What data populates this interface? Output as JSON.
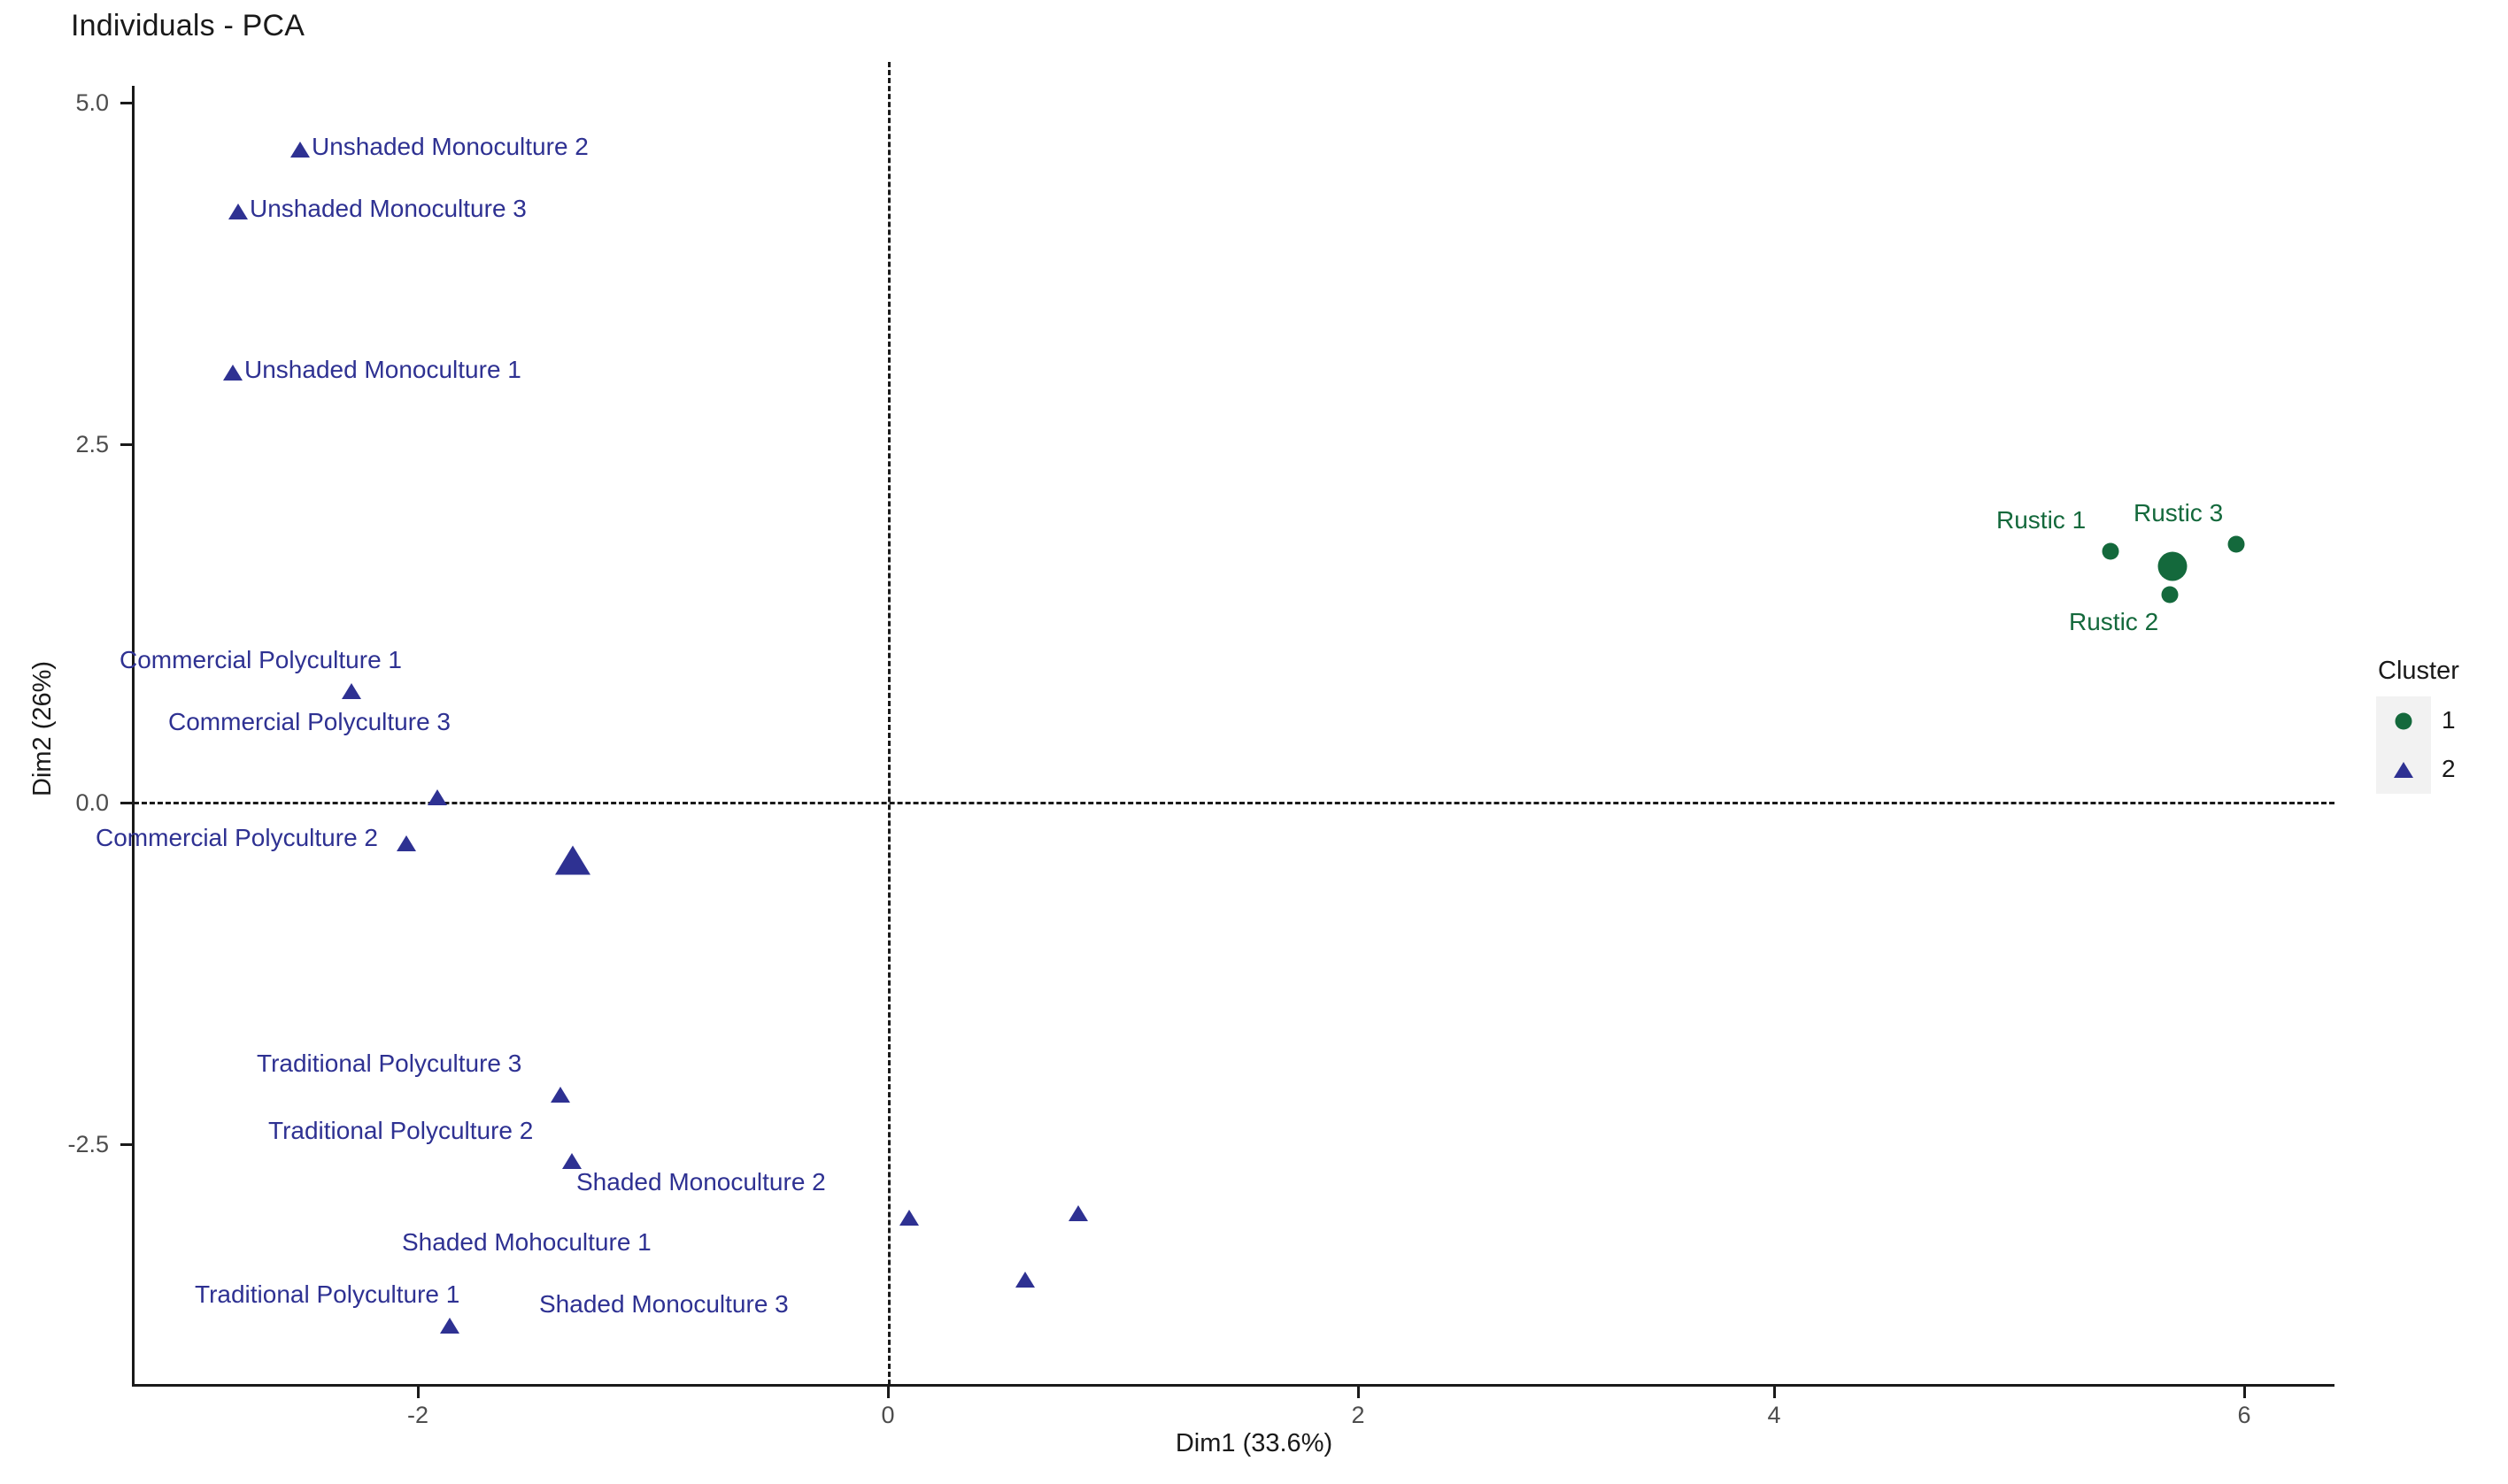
{
  "chart_data": {
    "type": "scatter",
    "title": "Individuals - PCA",
    "xlabel": "Dim1 (33.6%)",
    "ylabel": "Dim2 (26%)",
    "xlim": [
      -3.3,
      6.6
    ],
    "ylim": [
      -4.05,
      5.35
    ],
    "xticks": [
      -2,
      0,
      2,
      4,
      6
    ],
    "xtick_labels": [
      "-2",
      "0",
      "2",
      "4",
      "6"
    ],
    "yticks": [
      -2.5,
      0.0,
      2.5,
      5.0
    ],
    "ytick_labels": [
      "-2.5",
      "0.0",
      "2.5",
      "5.0"
    ],
    "grid": false,
    "reference_lines": {
      "h": 0.0,
      "v": 0.0,
      "style": "dashed"
    },
    "legend": {
      "title": "Cluster",
      "position": "right",
      "entries": [
        {
          "label": "1",
          "color": "#14693c",
          "marker": "circle"
        },
        {
          "label": "2",
          "color": "#2e3192",
          "marker": "triangle"
        }
      ]
    },
    "series": [
      {
        "name": "1",
        "color": "#14693c",
        "marker": "circle",
        "points": [
          {
            "label": "Rustic 1",
            "x": 5.19,
            "y": 1.79,
            "label_pos": "left-above"
          },
          {
            "label": "Rustic 2",
            "x": 5.45,
            "y": 1.47,
            "label_pos": "below"
          },
          {
            "label": "Rustic 3",
            "x": 5.73,
            "y": 1.84,
            "label_pos": "above"
          }
        ],
        "centroid": {
          "x": 5.46,
          "y": 1.69
        }
      },
      {
        "name": "2",
        "color": "#2e3192",
        "marker": "triangle",
        "points": [
          {
            "label": "Unshaded Monoculture 2",
            "x": -2.5,
            "y": 4.78,
            "label_pos": "right"
          },
          {
            "label": "Unshaded Monoculture 3",
            "x": -2.77,
            "y": 4.33,
            "label_pos": "right"
          },
          {
            "label": "Unshaded Monoculture 1",
            "x": -2.79,
            "y": 3.15,
            "label_pos": "right"
          },
          {
            "label": "Commercial Polyculture 1",
            "x": -2.28,
            "y": 0.82,
            "label_pos": "above"
          },
          {
            "label": "Commercial Polyculture 3",
            "x": -1.92,
            "y": 0.05,
            "label_pos": "above"
          },
          {
            "label": "Commercial Polyculture 2",
            "x": -2.05,
            "y": -0.29,
            "label_pos": "below-left"
          },
          {
            "label": "Traditional Polyculture 3",
            "x": -1.4,
            "y": -2.13,
            "label_pos": "above"
          },
          {
            "label": "Traditional Polyculture 2",
            "x": -1.35,
            "y": -2.62,
            "label_pos": "above"
          },
          {
            "label": "Traditional Polyculture 1",
            "x": -1.87,
            "y": -3.82,
            "label_pos": "above-left"
          },
          {
            "label": "Shaded Mohoculture 1",
            "x": 0.09,
            "y": -3.03,
            "label_pos": "below-left"
          },
          {
            "label": "Shaded Monoculture 2",
            "x": 0.81,
            "y": -3.0,
            "label_pos": "above"
          },
          {
            "label": "Shaded Monoculture 3",
            "x": 0.58,
            "y": -3.49,
            "label_pos": "below"
          }
        ],
        "centroid": {
          "x": -1.35,
          "y": -0.41
        }
      }
    ]
  },
  "plot": {
    "title": "Individuals - PCA",
    "axis_x_title": "Dim1 (33.6%)",
    "axis_y_title": "Dim2 (26%)",
    "x_tick_labels": [
      "-2",
      "0",
      "2",
      "4",
      "6"
    ],
    "y_tick_labels": [
      "5.0",
      "2.5",
      "0.0",
      "-2.5"
    ],
    "labels": {
      "um2": "Unshaded Monoculture 2",
      "um3": "Unshaded Monoculture 3",
      "um1": "Unshaded Monoculture 1",
      "cp1": "Commercial Polyculture 1",
      "cp3": "Commercial Polyculture 3",
      "cp2": "Commercial Polyculture 2",
      "tp3": "Traditional Polyculture 3",
      "tp2": "Traditional Polyculture 2",
      "tp1": "Traditional Polyculture 1",
      "sm1": "Shaded Mohoculture 1",
      "sm2": "Shaded Monoculture 2",
      "sm3": "Shaded Monoculture 3",
      "r1": "Rustic 1",
      "r2": "Rustic 2",
      "r3": "Rustic 3"
    }
  },
  "legend": {
    "title": "Cluster",
    "item1": "1",
    "item2": "2"
  }
}
